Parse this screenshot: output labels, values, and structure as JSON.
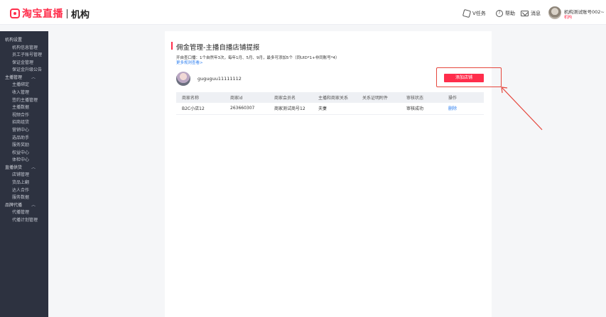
{
  "header": {
    "logo_text": "淘宝直播",
    "logo_sub": "机构",
    "nav": [
      {
        "label": "V任务",
        "icon": "task-icon"
      },
      {
        "label": "帮助",
        "icon": "help-icon"
      },
      {
        "label": "消息",
        "icon": "message-icon"
      }
    ],
    "user_name": "机构测试账号002~",
    "user_role": "机构"
  },
  "sidebar": {
    "groups": [
      {
        "label": "机构设置",
        "items": [
          "机构信息管理",
          "员工子账号管理",
          "保证金管理",
          "保证金升级公告"
        ]
      },
      {
        "label": "主播管理",
        "items": [
          "主播绑定",
          "收入管理",
          "签约主播管理",
          "主播数据",
          "视频合作",
          "招商组货",
          "营销中心",
          "选品助手",
          "服务奖励",
          "权益中心",
          "体检中心"
        ]
      },
      {
        "label": "直播供货",
        "items": [
          "店铺管理",
          "货品上翻",
          "达人合作",
          "服务数据"
        ]
      },
      {
        "label": "品牌代播",
        "items": [
          "代播管理",
          "代播计划管理"
        ]
      }
    ]
  },
  "main": {
    "title": "佣金管理-主播自播店铺提报",
    "rule_text": "开自查口播：1个自然年3次，每年1月、5月、9月，最多可添加5个（同UID*1+非同账号*4）",
    "rule_link": "更多规则查看>",
    "shop_name": "guguguu11111112",
    "add_button": "添加店铺",
    "table": {
      "headers": [
        "商家名称",
        "商家id",
        "商家会员名",
        "主播和商家关系",
        "关系证明附件",
        "审核状态",
        "操作"
      ],
      "rows": [
        [
          "B2C小店12",
          "263660307",
          "商家测试商号12",
          "夫妻",
          "",
          "审核成功",
          "删除"
        ]
      ]
    }
  },
  "colors": {
    "brand": "#ff2d4b",
    "link": "#2e7ff0",
    "sidebar_bg": "#2d3240",
    "annotation": "#e5473d"
  }
}
